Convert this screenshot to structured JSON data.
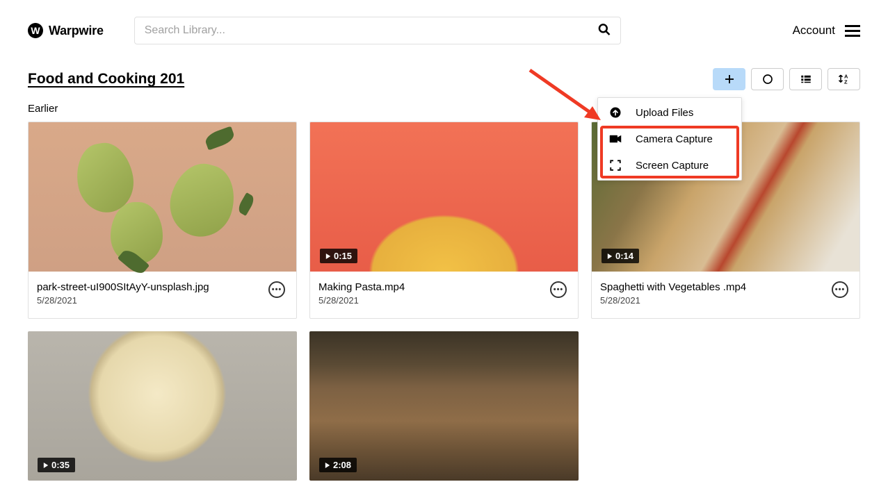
{
  "brand": {
    "name": "Warpwire",
    "glyph": "W"
  },
  "search": {
    "placeholder": "Search Library..."
  },
  "header": {
    "account": "Account"
  },
  "page": {
    "title": "Food and Cooking 201"
  },
  "toolbar": {
    "add": "add-button",
    "record": "record-button",
    "list": "list-view-button",
    "sort": "sort-button"
  },
  "section": {
    "label": "Earlier"
  },
  "dropdown": {
    "items": [
      {
        "label": "Upload Files",
        "icon": "upload-icon"
      },
      {
        "label": "Camera Capture",
        "icon": "camera-icon"
      },
      {
        "label": "Screen Capture",
        "icon": "screen-capture-icon"
      }
    ]
  },
  "items": [
    {
      "title": "park-street-uI900SItAyY-unsplash.jpg",
      "date": "5/28/2021",
      "duration": null
    },
    {
      "title": "Making Pasta.mp4",
      "date": "5/28/2021",
      "duration": "0:15"
    },
    {
      "title": "Spaghetti with Vegetables .mp4",
      "date": "5/28/2021",
      "duration": "0:14"
    },
    {
      "title": "",
      "date": "",
      "duration": "0:35"
    },
    {
      "title": "",
      "date": "",
      "duration": "2:08"
    }
  ]
}
